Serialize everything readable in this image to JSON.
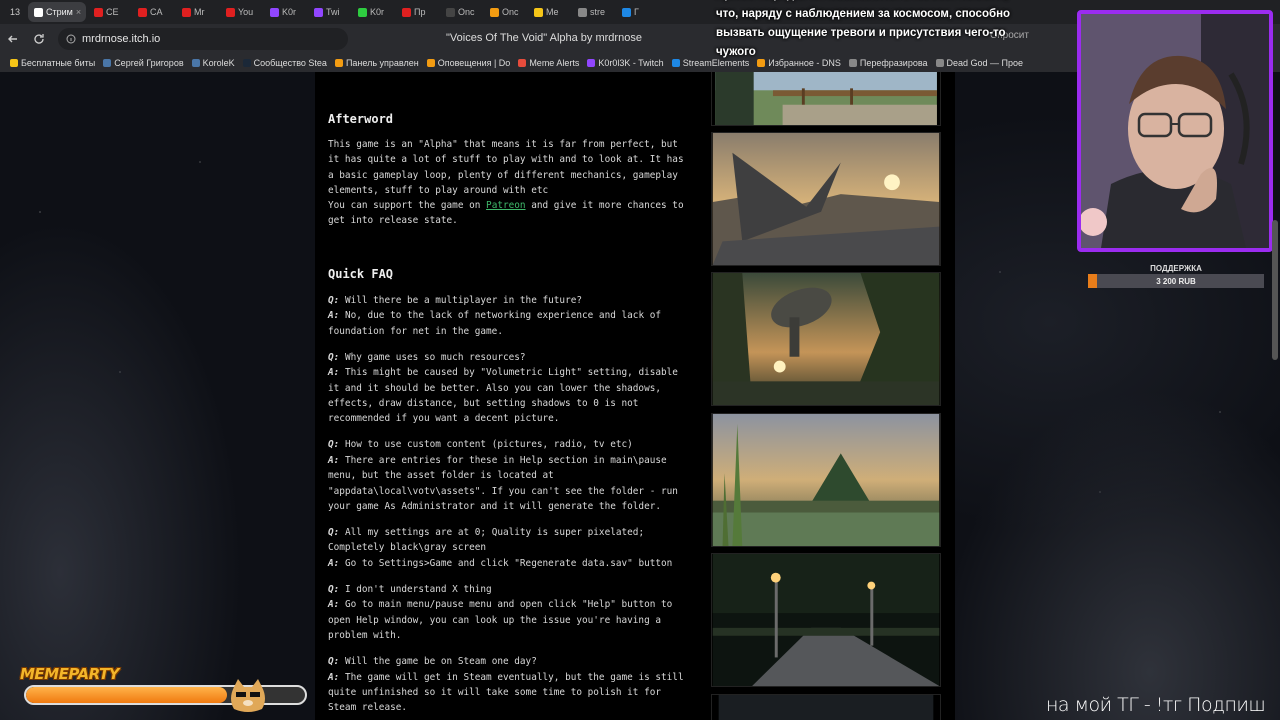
{
  "browser": {
    "tab_count": "13",
    "tabs": [
      {
        "label": "Стрим",
        "active": true,
        "color": "#ffffff"
      },
      {
        "label": "CE",
        "color": "#e02020"
      },
      {
        "label": "CA",
        "color": "#e02020"
      },
      {
        "label": "Mr",
        "color": "#e02020"
      },
      {
        "label": "You",
        "color": "#e02020"
      },
      {
        "label": "K0r",
        "color": "#9146ff"
      },
      {
        "label": "Twi",
        "color": "#9146ff"
      },
      {
        "label": "K0r",
        "color": "#2ecc40"
      },
      {
        "label": "Пр",
        "color": "#e02020"
      },
      {
        "label": "Onc",
        "color": "#444444"
      },
      {
        "label": "Onc",
        "color": "#f39c12"
      },
      {
        "label": "Me",
        "color": "#f5c518"
      },
      {
        "label": "stre",
        "color": "#888888"
      },
      {
        "label": "Г",
        "color": "#1e88e5"
      }
    ],
    "url": "mrdrnose.itch.io",
    "title": "\"Voices Of The Void\" Alpha by mrdrnose",
    "right_text": "Спросит",
    "bookmarks": [
      {
        "label": "Бесплатные биты",
        "color": "#f5c518"
      },
      {
        "label": "Сергей Григоров",
        "color": "#4a76a8"
      },
      {
        "label": "KoroleK",
        "color": "#4a76a8"
      },
      {
        "label": "Сообщество Stea",
        "color": "#1b2838"
      },
      {
        "label": "Панель управлен",
        "color": "#f39c12"
      },
      {
        "label": "Оповещения | Do",
        "color": "#f39c12"
      },
      {
        "label": "Meme Alerts",
        "color": "#e74c3c"
      },
      {
        "label": "K0r0l3K - Twitch",
        "color": "#9146ff"
      },
      {
        "label": "StreamElements",
        "color": "#1e88e5"
      },
      {
        "label": "Избранное - DNS",
        "color": "#f39c12"
      },
      {
        "label": "Перефразирова",
        "color": "#888888"
      },
      {
        "label": "Dead God — Прое",
        "color": "#888888"
      }
    ]
  },
  "page": {
    "afterword_heading": "Afterword",
    "afterword_lines": [
      "This game is an \"Alpha\" that means it is far from perfect, but",
      "it has quite a lot of stuff to play with and to look at. It has",
      "a basic gameplay loop, plenty of different mechanics, gameplay",
      "elements, stuff to play around with etc"
    ],
    "support_prefix": "You can support the game on ",
    "support_link": "Patreon",
    "support_suffix": " and give it more chances to",
    "support_line2": "get into release state.",
    "faq_heading": "Quick FAQ",
    "q_prefix": "Q:",
    "a_prefix": "A:",
    "faq": [
      {
        "q": [
          " Will there be a multiplayer in the future?"
        ],
        "a": [
          " No, due to the lack of networking experience and lack of",
          "foundation for net in the game."
        ]
      },
      {
        "q": [
          " Why game uses so much resources?"
        ],
        "a": [
          " This might be caused by \"Volumetric Light\" setting, disable",
          "it and it should be better. Also you can lower the shadows,",
          "effects, draw distance, but setting shadows to 0 is not",
          "recommended if you want a decent picture."
        ]
      },
      {
        "q": [
          " How to use custom content (pictures, radio, tv etc)"
        ],
        "a": [
          " There are entries for these in Help section in main\\pause",
          "menu, but the asset folder is located at",
          "\"appdata\\local\\votv\\assets\". If you can't see the folder - run",
          "your game As Administrator and it will generate the folder."
        ]
      },
      {
        "q": [
          " All my settings are at 0; Quality is super pixelated;",
          "Completely black\\gray screen"
        ],
        "a": [
          " Go to Settings>Game and click \"Regenerate data.sav\" button"
        ]
      },
      {
        "q": [
          " I don't understand X thing"
        ],
        "a": [
          " Go to main menu/pause menu and open click \"Help\" button to",
          "open Help window, you can look up the issue you're having a",
          "problem with."
        ]
      },
      {
        "q": [
          " Will the game be on Steam one day?"
        ],
        "a": [
          " The game will get in Steam eventually, but the game is still",
          "quite unfinished so it will take some time to polish it for",
          "Steam release."
        ]
      }
    ]
  },
  "stream": {
    "caption_lines": [
      "Проект порядко он оказывается в полной темноте,",
      "что, наряду с наблюдением за космосом, способно",
      "вызвать ощущение тревоги и присутствия чего-то",
      "чужого"
    ],
    "support_label": "ПОДДЕРЖКА",
    "support_amount": "3 200 RUB",
    "support_progress": 0.05,
    "meme_title": "MEMEPARTY",
    "meme_progress": 0.72,
    "marquee": "на мой ТГ - !тг Подпиш"
  }
}
